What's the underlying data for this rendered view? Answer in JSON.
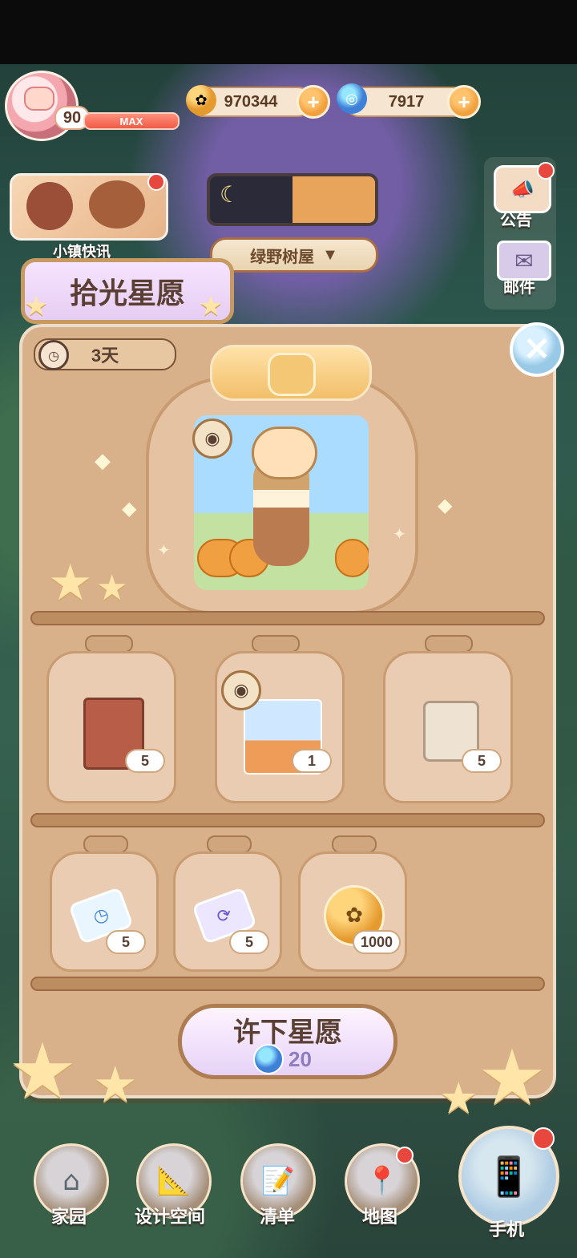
{
  "hud": {
    "level": "90",
    "level_max": "MAX",
    "coins": "970344",
    "gems": "7917",
    "plus": "+"
  },
  "side": {
    "news_label": "小镇快讯",
    "location": "绿野树屋",
    "notice_label": "公告",
    "mail_label": "邮件"
  },
  "panel": {
    "title": "拾光星愿",
    "timer": "3天",
    "close": "✕"
  },
  "rewards": {
    "featured": {
      "name": "autumn-outfit"
    },
    "row1": [
      {
        "count": "5",
        "item": "book"
      },
      {
        "count": "1",
        "item": "photo"
      },
      {
        "count": "5",
        "item": "scroll"
      }
    ],
    "row2": [
      {
        "count": "5",
        "item": "ticket-blue"
      },
      {
        "count": "5",
        "item": "ticket-purple"
      },
      {
        "count": "1000",
        "item": "coin"
      }
    ]
  },
  "wish_button": {
    "label": "许下星愿",
    "cost": "20"
  },
  "nav": {
    "home": "家园",
    "design": "设计空间",
    "list": "清单",
    "map": "地图",
    "phone": "手机"
  }
}
